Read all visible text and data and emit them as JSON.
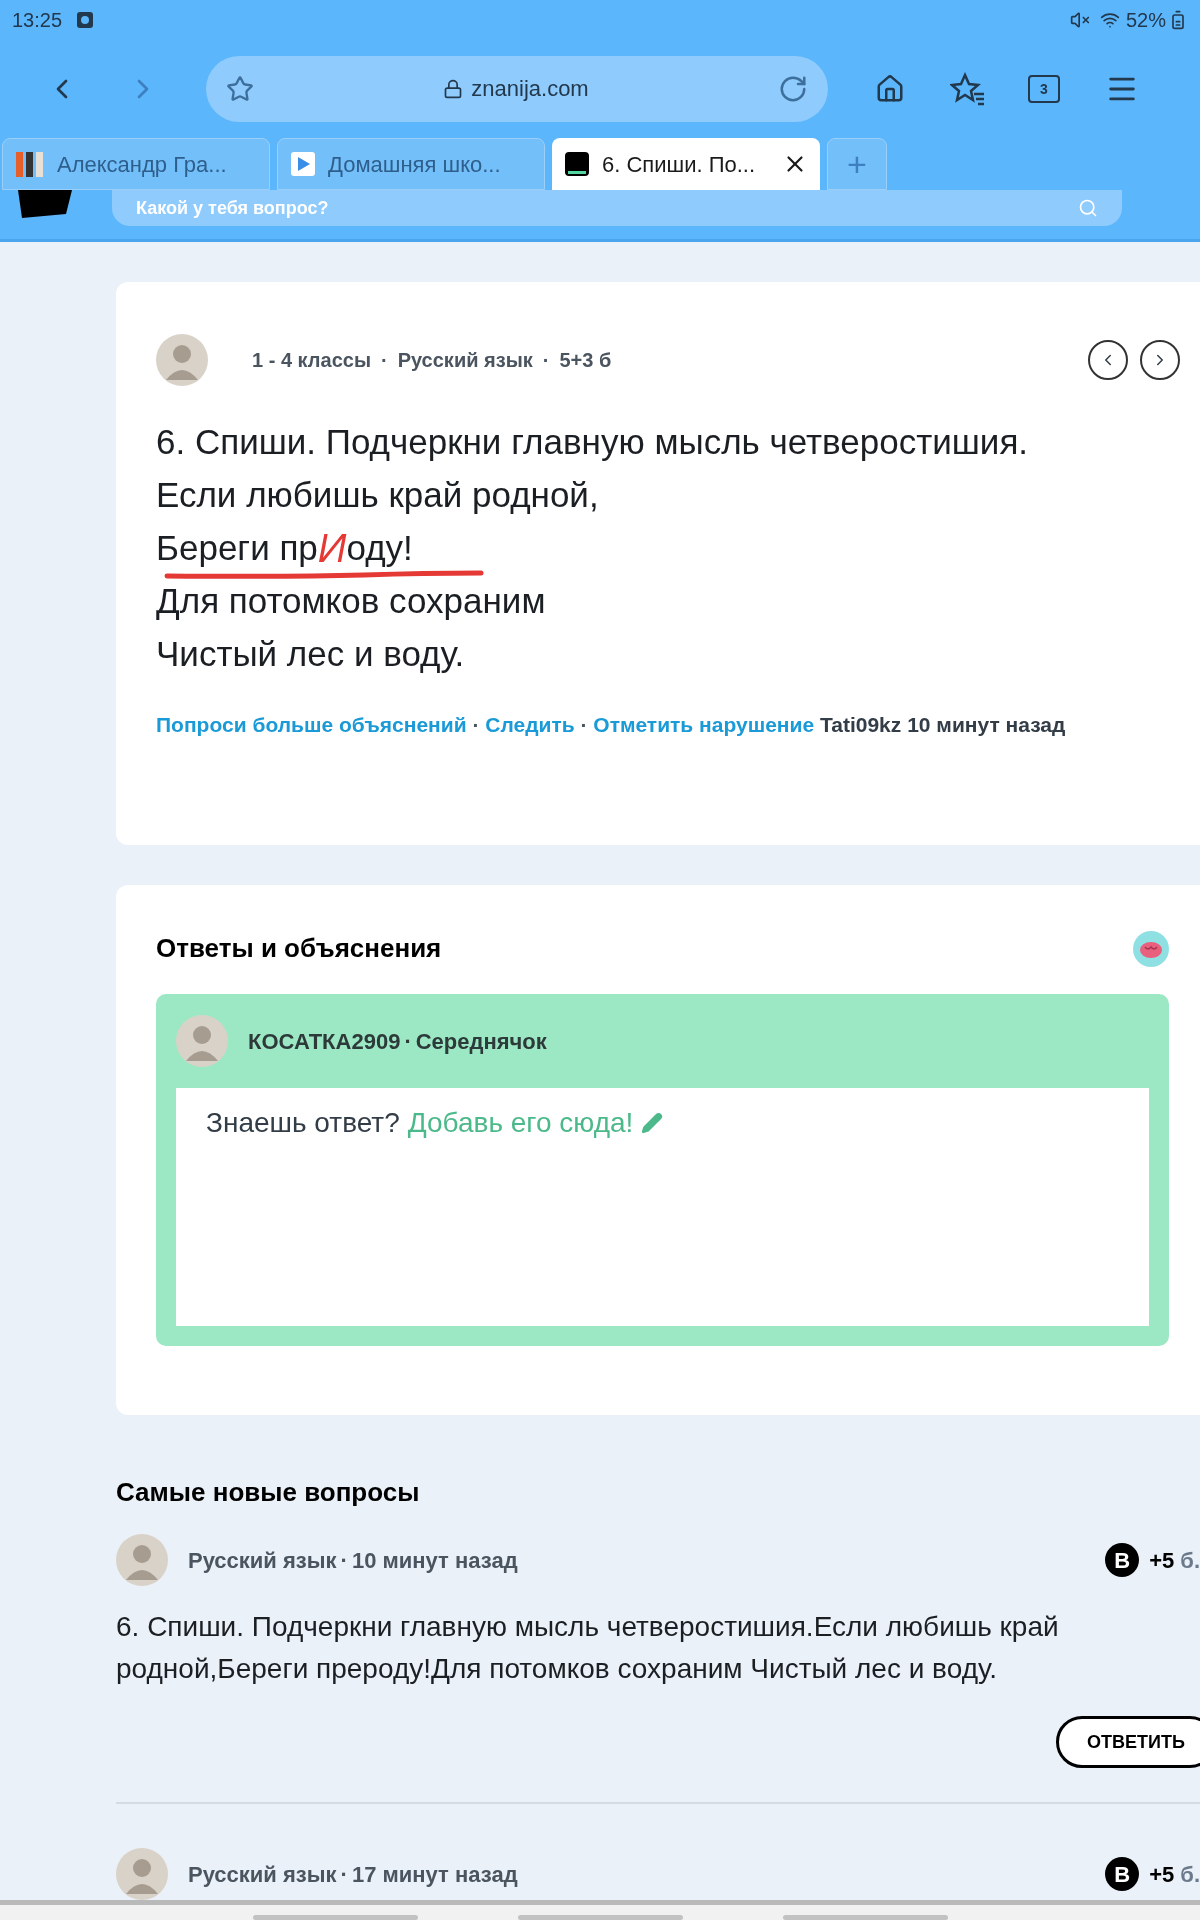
{
  "status_bar": {
    "time": "13:25",
    "battery": "52%"
  },
  "toolbar": {
    "url": "znanija.com",
    "tab_count": "3"
  },
  "tabs": [
    {
      "label": "Александр Гра...",
      "selected": false,
      "kind": "books"
    },
    {
      "label": "Домашняя шко...",
      "selected": false,
      "kind": "play"
    },
    {
      "label": "6. Спиши. По...",
      "selected": true,
      "kind": "site"
    }
  ],
  "new_tab": "+",
  "site_header": {
    "search_placeholder": "Какой у тебя вопрос?"
  },
  "question": {
    "meta": [
      "1 - 4 классы",
      "Русский язык",
      "5+3 б"
    ],
    "separator": "·",
    "lines": [
      {
        "kind": "plain",
        "text": "6. Спиши. Подчеркни главную мысль четверостишия."
      },
      {
        "kind": "plain",
        "text": "Если любишь край родной,"
      },
      {
        "kind": "corrected",
        "before": "Береги пр",
        "correction": "И",
        "after": "оду!",
        "color": "#e53935"
      },
      {
        "kind": "plain",
        "text": "Для потомков сохраним"
      },
      {
        "kind": "plain",
        "text": "Чистый лес и воду."
      }
    ],
    "actions": [
      "Попроси больше объяснений",
      "Следить",
      "Отметить нарушение"
    ],
    "author": "Tati09kz",
    "time": "10 минут назад"
  },
  "answers": {
    "title": "Ответы и объяснения",
    "user": "КОСАТКА2909",
    "separator": "·",
    "rank": "Середнячок",
    "prompt": "Знаешь ответ?",
    "link": "Добавь его сюда!"
  },
  "newest": {
    "title": "Самые новые вопросы",
    "items": [
      {
        "subject": "Русский язык",
        "separator": "·",
        "time": "10 минут назад",
        "badge": "B",
        "points": "+5",
        "unit": "б.",
        "text": "6. Спиши. Подчеркни главную мысль четверостишия.Если любишь край родной,Береги прероду!Для потомков сохраним Чистый лес и воду.",
        "button": "ОТВЕТИТЬ"
      },
      {
        "subject": "Русский язык",
        "separator": "·",
        "time": "17 минут назад",
        "badge": "B",
        "points": "+5",
        "unit": "б."
      }
    ]
  }
}
